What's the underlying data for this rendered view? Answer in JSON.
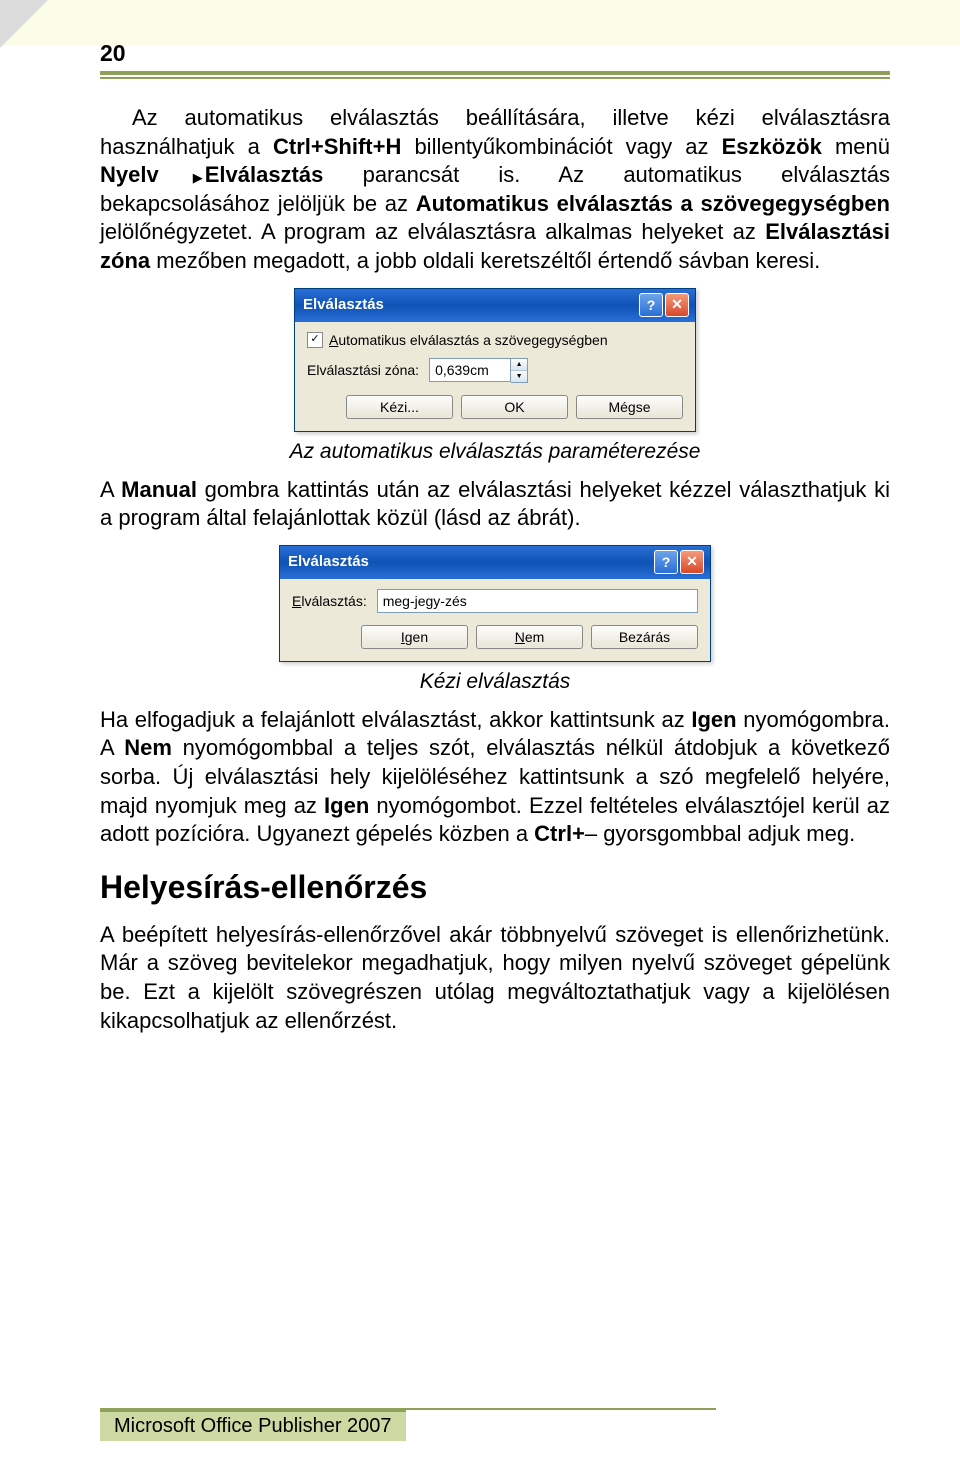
{
  "page_number": "20",
  "para1_a": "Az automatikus elválasztás beállítására, illetve kézi elválasztásra használhatjuk a ",
  "para1_b": "Ctrl+Shift+H",
  "para1_c": " billentyűkombinációt vagy az ",
  "para1_d": "Eszközök",
  "para1_e": " menü ",
  "para1_f": "Nyelv",
  "para1_g": "Elválasztás",
  "para1_h": " parancsát is. Az automatikus elválasztás bekapcsolásához jelöljük be az ",
  "para1_i": "Automatikus elválasztás a szövegegységben",
  "para1_j": " jelölőnégyzetet. A program az elválasztásra alkalmas helyeket az ",
  "para1_k": "Elválasztási zóna",
  "para1_l": " mezőben megadott, a jobb oldali keretszéltől értendő sávban keresi.",
  "dialog1": {
    "title": "Elválasztás",
    "checkbox_label_pre": "A",
    "checkbox_label": "utomatikus elválasztás a szövegegységben",
    "zone_label": "Elválasztási zóna:",
    "zone_value": "0,639cm",
    "btn_kezi": "Kézi...",
    "btn_ok": "OK",
    "btn_megse": "Mégse"
  },
  "caption1": "Az automatikus elválasztás paraméterezése",
  "para2_a": "A ",
  "para2_b": "Manual",
  "para2_c": " gombra kattintás után az elválasztási helyeket kézzel választhatjuk ki a program által felajánlottak közül (lásd az ábrát).",
  "dialog2": {
    "title": "Elválasztás",
    "label_pre": "E",
    "label": "lválasztás:",
    "value": "meg-jegy-zés",
    "btn_igen_pre": "I",
    "btn_igen": "gen",
    "btn_nem_pre": "N",
    "btn_nem": "em",
    "btn_bezaras": "Bezárás"
  },
  "caption2": "Kézi elválasztás",
  "para3_a": "Ha elfogadjuk a felajánlott elválasztást, akkor kattintsunk az ",
  "para3_b": "Igen",
  "para3_c": " nyomógombra. A ",
  "para3_d": "Nem",
  "para3_e": " nyomógombbal a teljes szót, elválasztás nélkül átdobjuk a következő sorba. Új elválasztási hely kijelöléséhez kattintsunk a szó megfelelő helyére, majd nyomjuk meg az ",
  "para3_f": "Igen",
  "para3_g": " nyomógombot. Ezzel feltételes elválasztójel kerül az adott pozícióra. Ugyanezt gépelés közben a ",
  "para3_h": "Ctrl+",
  "para3_i": "– gyorsgombbal adjuk meg.",
  "heading": "Helyesírás-ellenőrzés",
  "para4": "A beépített helyesírás-ellenőrzővel akár többnyelvű szöveget is ellenőrizhetünk. Már a szöveg bevitelekor megadhatjuk, hogy milyen nyelvű szöveget gépelünk be. Ezt a kijelölt szövegrészen utólag megváltoztathatjuk vagy a kijelölésen kikapcsolhatjuk az ellenőrzést.",
  "footer": "Microsoft Office Publisher 2007"
}
